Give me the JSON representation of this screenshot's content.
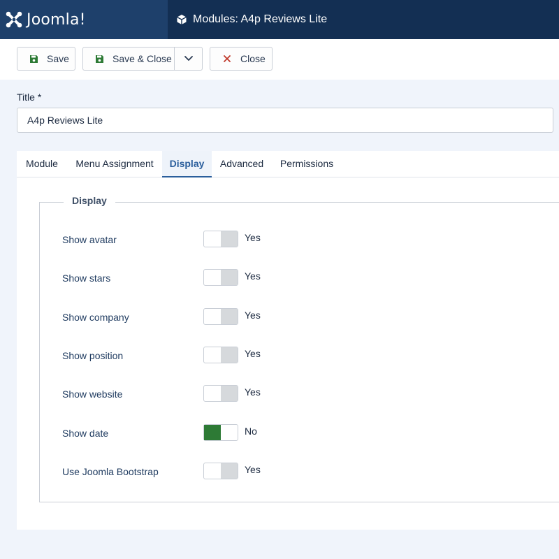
{
  "header": {
    "brand": "Joomla!",
    "page_title": "Modules: A4p Reviews Lite"
  },
  "toolbar": {
    "save_label": "Save",
    "save_close_label": "Save & Close",
    "close_label": "Close"
  },
  "form": {
    "title_label": "Title *",
    "title_value": "A4p Reviews Lite"
  },
  "tabs": [
    {
      "label": "Module"
    },
    {
      "label": "Menu Assignment"
    },
    {
      "label": "Display",
      "active": true
    },
    {
      "label": "Advanced"
    },
    {
      "label": "Permissions"
    }
  ],
  "display": {
    "legend": "Display",
    "rows": [
      {
        "label": "Show avatar",
        "value": "Yes",
        "on": false
      },
      {
        "label": "Show stars",
        "value": "Yes",
        "on": false
      },
      {
        "label": "Show company",
        "value": "Yes",
        "on": false
      },
      {
        "label": "Show position",
        "value": "Yes",
        "on": false
      },
      {
        "label": "Show website",
        "value": "Yes",
        "on": false
      },
      {
        "label": "Show date",
        "value": "No",
        "on": true
      },
      {
        "label": "Use Joomla Bootstrap",
        "value": "Yes",
        "on": false
      }
    ]
  },
  "colors": {
    "header_bg": "#132f53",
    "brand_bg": "#1e406b",
    "save_icon": "#2d7a35",
    "close_icon": "#c0392b",
    "switch_on": "#2d7a35",
    "active_tab": "#2a5e9c"
  },
  "icons": {
    "brand": "joomla-logo-icon",
    "title": "cube-icon",
    "save": "floppy-disk-icon",
    "save_close": "floppy-disk-icon",
    "dropdown": "chevron-down-icon",
    "close": "x-icon"
  }
}
